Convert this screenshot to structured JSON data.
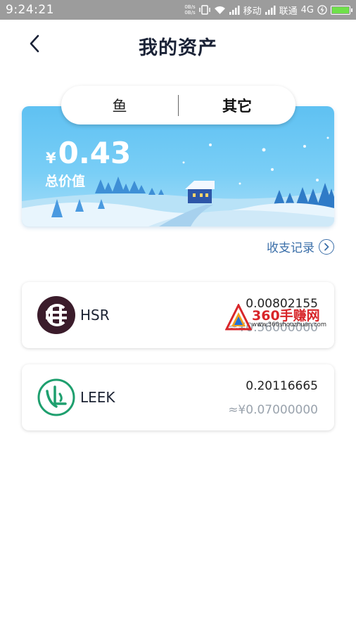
{
  "status_bar": {
    "time": "9:24:21",
    "speed_up": "0B/s",
    "speed_down": "0B/s",
    "carrier1": "移动",
    "carrier2": "联通",
    "network": "4G",
    "battery_level": 1.0,
    "battery_color": "#6fe04a"
  },
  "header": {
    "title": "我的资产",
    "back_icon": "chevron-left-icon"
  },
  "tabs": [
    {
      "label": "鱼",
      "active": false
    },
    {
      "label": "其它",
      "active": true
    }
  ],
  "summary": {
    "currency_symbol": "¥",
    "total_value": "0.43",
    "total_label": "总价值"
  },
  "records_link": {
    "label": "收支记录",
    "icon": "chevron-right-circle-icon"
  },
  "assets": [
    {
      "symbol": "HSR",
      "quantity": "0.00802155",
      "cny_value": "≈¥0.56000000",
      "logo_color": "#3b1c2b"
    },
    {
      "symbol": "LEEK",
      "quantity": "0.20116665",
      "cny_value": "≈¥0.07000000",
      "logo_color": "#1e9f6e"
    }
  ],
  "watermark": {
    "text": "360手赚网",
    "url": "www.360shouzhuan.com"
  },
  "colors": {
    "accent_link": "#3b6fa9",
    "banner_sky": "#5fc1f2"
  }
}
